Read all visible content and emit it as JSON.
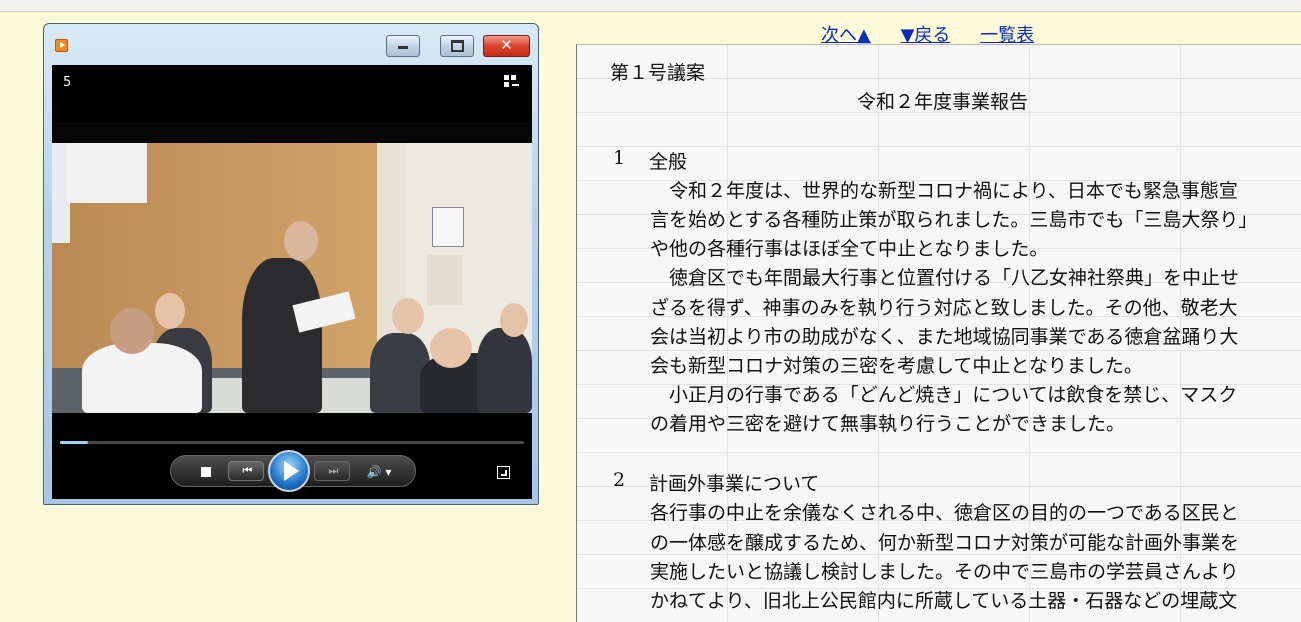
{
  "player": {
    "chapter_number": "5",
    "window_buttons": {
      "minimize": "—",
      "maximize": "□",
      "close": "✕"
    },
    "progress_fraction": 0.06,
    "controls": {
      "prev": "⏮",
      "next": "⏭",
      "volume": "🔊 ▾"
    }
  },
  "nav": {
    "next": "次へ▲",
    "back": "▼戻る",
    "list": "一覧表"
  },
  "document": {
    "bill_no": "第１号議案",
    "title": "令和２年度事業報告",
    "sections": [
      {
        "num": "1",
        "heading": "全般",
        "lines": [
          "　令和２年度は、世界的な新型コロナ禍により、日本でも緊急事態宣",
          "言を始めとする各種防止策が取られました。三島市でも「三島大祭り」",
          "や他の各種行事はほぼ全て中止となりました。",
          "　徳倉区でも年間最大行事と位置付ける「八乙女神社祭典」を中止せ",
          "ざるを得ず、神事のみを執り行う対応と致しました。その他、敬老大",
          "会は当初より市の助成がなく、また地域協同事業である徳倉盆踊り大",
          "会も新型コロナ対策の三密を考慮して中止となりました。",
          "　小正月の行事である「どんど焼き」については飲食を禁じ、マスク",
          "の着用や三密を避けて無事執り行うことができました。"
        ]
      },
      {
        "num": "2",
        "heading": "計画外事業について",
        "lines": [
          "各行事の中止を余儀なくされる中、徳倉区の目的の一つである区民と",
          "の一体感を醸成するため、何か新型コロナ対策が可能な計画外事業を",
          "実施したいと協議し検討しました。その中で三島市の学芸員さんより",
          "かねてより、旧北上公民館内に所蔵している土器・石器などの埋蔵文"
        ]
      }
    ]
  }
}
